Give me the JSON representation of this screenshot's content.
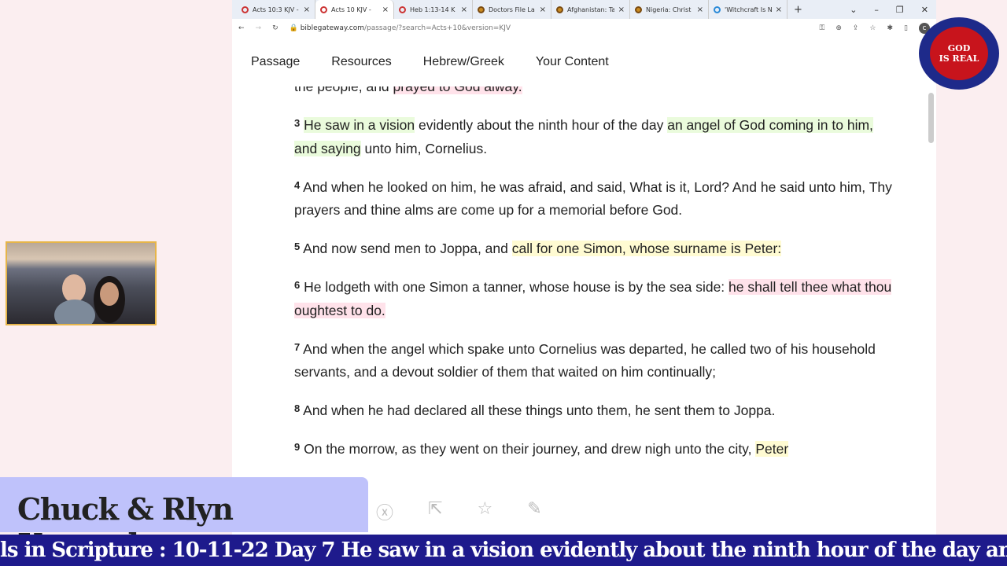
{
  "browser": {
    "tabs": [
      {
        "label": "Acts 10:3 KJV -",
        "icon": "biblegateway-icon"
      },
      {
        "label": "Acts 10 KJV -",
        "icon": "biblegateway-icon",
        "active": true
      },
      {
        "label": "Heb 1:13-14 K",
        "icon": "biblegateway-icon"
      },
      {
        "label": "Doctors File La",
        "icon": "site-icon"
      },
      {
        "label": "Afghanistan: Ta",
        "icon": "site-icon"
      },
      {
        "label": "Nigeria: Christ",
        "icon": "site-icon"
      },
      {
        "label": "'Witchcraft Is N",
        "icon": "drop-icon"
      }
    ],
    "url_host": "biblegateway.com",
    "url_path": "/passage/?search=Acts+10&version=KJV"
  },
  "nav": [
    "Passage",
    "Resources",
    "Hebrew/Greek",
    "Your Content"
  ],
  "verses": [
    {
      "num": "",
      "segs": [
        [
          "the people, and ",
          ""
        ],
        [
          "prayed to God alway.",
          "p"
        ]
      ]
    },
    {
      "num": "3",
      "segs": [
        [
          "He saw in a vision",
          "g"
        ],
        [
          " evidently about the ninth hour of the day ",
          ""
        ],
        [
          "an angel of God coming in to him, and saying",
          "g"
        ],
        [
          " unto him, Cornelius.",
          ""
        ]
      ]
    },
    {
      "num": "4",
      "segs": [
        [
          "And when he looked on him, he was afraid, and said, What is it, Lord? And he said unto him, Thy prayers and thine alms are come up for a memorial before God.",
          ""
        ]
      ]
    },
    {
      "num": "5",
      "segs": [
        [
          "And now send men to Joppa, and ",
          ""
        ],
        [
          "call for one Simon, whose surname is Peter:",
          "y"
        ]
      ]
    },
    {
      "num": "6",
      "segs": [
        [
          "He lodgeth with one Simon a tanner, whose house is by the sea side: ",
          ""
        ],
        [
          "he shall tell thee what thou oughtest to do.",
          "p"
        ]
      ]
    },
    {
      "num": "7",
      "segs": [
        [
          "And when the angel which spake unto Cornelius was departed, he called two of his household servants, and a devout soldier of them that waited on him continually;",
          ""
        ]
      ]
    },
    {
      "num": "8",
      "segs": [
        [
          "And when he had declared all these things unto them, he sent them to Joppa.",
          ""
        ]
      ]
    },
    {
      "num": "9",
      "segs": [
        [
          "On the morrow, as they went on their journey, and drew nigh unto the city, ",
          ""
        ],
        [
          "Peter",
          "y"
        ]
      ]
    }
  ],
  "logo": {
    "text": "GOD IS REAL",
    "ring": "FAITH INTERNATIONAL CHRISTIAN CENTER, BRADENTON, FLORIDA, U.S.A"
  },
  "overlay": {
    "name": "Chuck & Rlyn Kennedy",
    "ticker": "ls in Scripture : 10-11-22 Day 7 He saw in a vision evidently about the ninth hour of the day an ange"
  },
  "colors": {
    "green_highlight": "#eafbdc",
    "yellow_highlight": "#fffbd2",
    "pink_highlight": "#ffe2ea",
    "ticker_bg": "#1e1a8c",
    "name_bg": "#bfc2fb"
  }
}
